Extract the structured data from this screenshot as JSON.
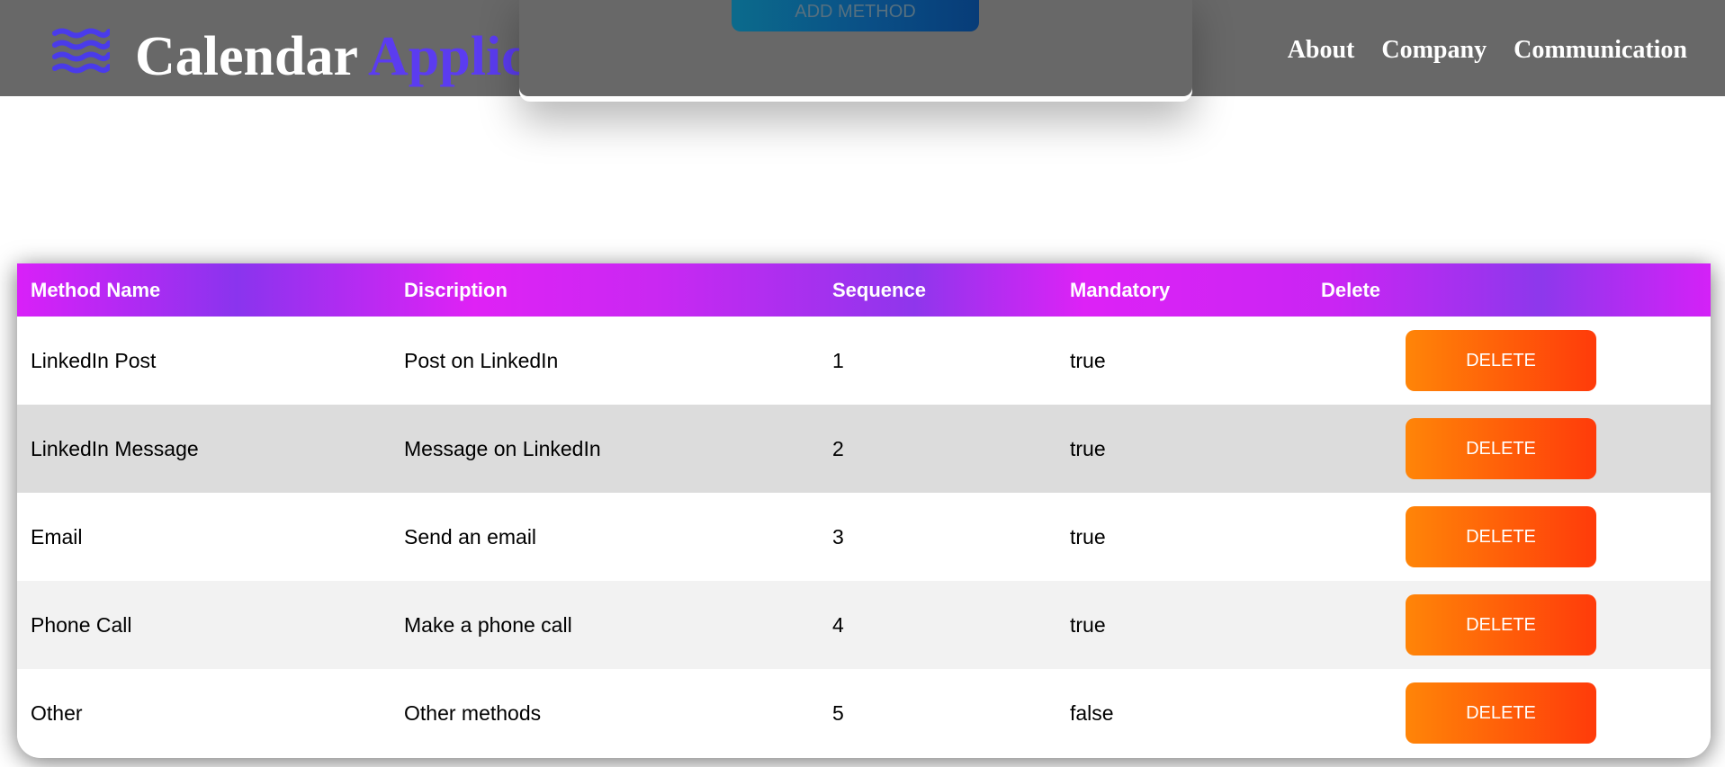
{
  "navbar": {
    "brand_primary": "Calendar",
    "brand_accent": "Application",
    "links": [
      "About",
      "Company",
      "Communication"
    ]
  },
  "overlay": {
    "add_method_label": "ADD METHOD"
  },
  "table": {
    "headers": [
      "Method Name",
      "Discription",
      "Sequence",
      "Mandatory",
      "Delete"
    ],
    "rows": [
      {
        "name": "LinkedIn Post",
        "description": "Post on LinkedIn",
        "sequence": "1",
        "mandatory": "true",
        "delete_label": "DELETE"
      },
      {
        "name": "LinkedIn Message",
        "description": "Message on LinkedIn",
        "sequence": "2",
        "mandatory": "true",
        "delete_label": "DELETE"
      },
      {
        "name": "Email",
        "description": "Send an email",
        "sequence": "3",
        "mandatory": "true",
        "delete_label": "DELETE"
      },
      {
        "name": "Phone Call",
        "description": "Make a phone call",
        "sequence": "4",
        "mandatory": "true",
        "delete_label": "DELETE"
      },
      {
        "name": "Other",
        "description": "Other methods",
        "sequence": "5",
        "mandatory": "false",
        "delete_label": "DELETE"
      }
    ]
  },
  "icons": {
    "logo": "waves-icon"
  },
  "colors": {
    "navbar_bg": "#686868",
    "brand_accent": "#5b3cf0",
    "header_gradient": [
      "#d920f8",
      "#8a34ee"
    ],
    "delete_gradient": [
      "#ff8508",
      "#ff3b0a"
    ],
    "add_button_gradient": [
      "#0b6b8c",
      "#073c78"
    ]
  }
}
